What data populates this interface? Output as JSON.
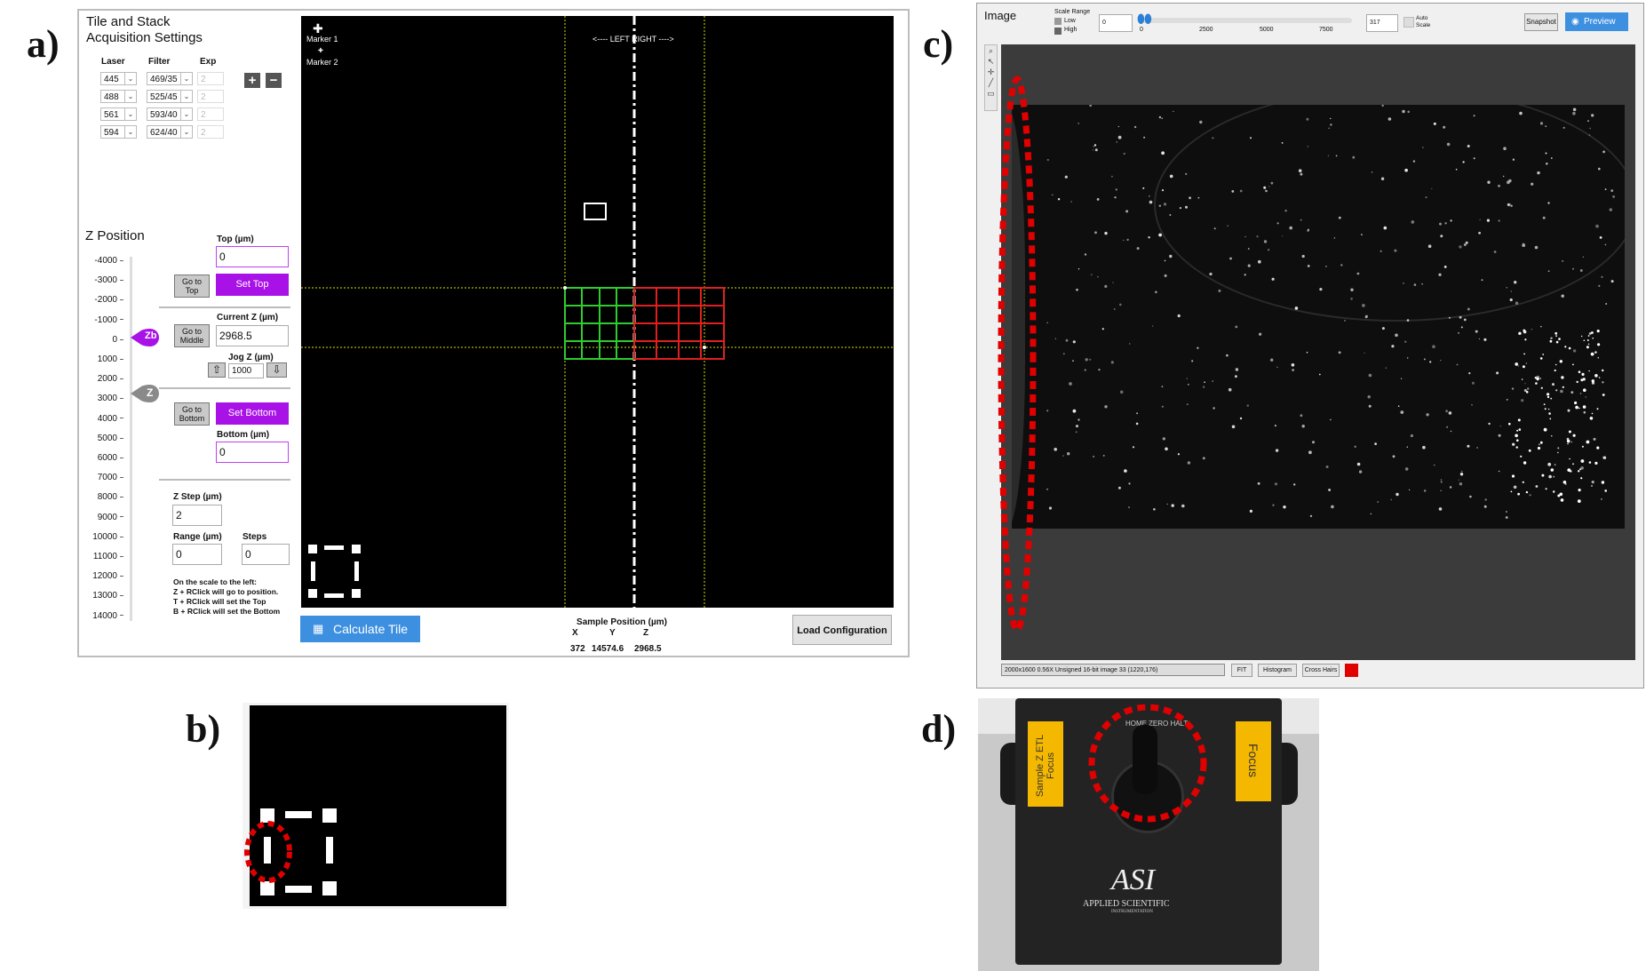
{
  "panel_labels": {
    "a": "a)",
    "b": "b)",
    "c": "c)",
    "d": "d)"
  },
  "tile": {
    "title_line1": "Tile and Stack",
    "title_line2": "Acquisition Settings",
    "col_laser": "Laser",
    "col_filter": "Filter",
    "col_exp": "Exp",
    "rows": [
      {
        "laser": "445",
        "filter": "469/35",
        "exp": "2"
      },
      {
        "laser": "488",
        "filter": "525/45",
        "exp": "2"
      },
      {
        "laser": "561",
        "filter": "593/40",
        "exp": "2"
      },
      {
        "laser": "594",
        "filter": "624/40",
        "exp": "2"
      }
    ],
    "plus": "+",
    "minus": "−",
    "z_position": "Z Position",
    "ticks": [
      "-4000",
      "-3000",
      "-2000",
      "-1000",
      "0",
      "1000",
      "2000",
      "3000",
      "4000",
      "5000",
      "6000",
      "7000",
      "8000",
      "9000",
      "10000",
      "11000",
      "12000",
      "13000",
      "14000"
    ],
    "zb_marker": "Zb",
    "z_marker": "Z",
    "top_label": "Top (µm)",
    "top_value": "0",
    "go_to_top": "Go to Top",
    "set_top": "Set Top",
    "current_z_label": "Current Z (µm)",
    "current_z_value": "2968.5",
    "go_to_middle": "Go to Middle",
    "jog_label": "Jog Z (µm)",
    "jog_value": "1000",
    "jog_up": "⇧",
    "jog_down": "⇩",
    "go_to_bottom": "Go to Bottom",
    "set_bottom": "Set Bottom",
    "bottom_label": "Bottom (µm)",
    "bottom_value": "0",
    "zstep_label": "Z Step (µm)",
    "zstep_value": "2",
    "range_label": "Range (µm)",
    "range_value": "0",
    "steps_label": "Steps",
    "steps_value": "0",
    "help_lines": [
      "On the scale to the left:",
      "Z + RClick will go to position.",
      "T + RClick will set the Top",
      "B + RClick will set the Bottom"
    ],
    "marker1": "Marker 1",
    "marker2": "Marker 2",
    "left_right": "<---- LEFT   RIGHT ---->",
    "calculate_tile": "Calculate Tile",
    "sample_pos_label": "Sample Position (µm)",
    "axes": [
      "X",
      "Y",
      "Z"
    ],
    "pos_values": [
      "372",
      "14574.6",
      "2968.5"
    ],
    "load_configuration": "Load Configuration",
    "colors": {
      "accent": "#a812e6",
      "button_blue": "#3d8fe0",
      "grid_green": "#2ecc2e",
      "grid_red": "#e02020"
    }
  },
  "image": {
    "title": "Image",
    "scale_range": "Scale Range",
    "low": "Low",
    "high": "High",
    "min_value": "0",
    "slider_ticks": [
      "0",
      "2500",
      "5000",
      "7500"
    ],
    "max_value": "317",
    "auto_scale": "Auto Scale",
    "snapshot": "Snapshot",
    "preview": "Preview",
    "status": "2000x1600 0.56X Unsigned 16-bit image 33    (1220,176)",
    "fit": "FIT",
    "histogram": "Histogram",
    "cross_hairs": "Cross Hairs"
  },
  "device": {
    "label_left": "Sample Z ETL Focus",
    "label_right": "Focus",
    "home": "HOME",
    "zero_halt": "ZERO HALT",
    "brand": "ASI",
    "company": "APPLIED SCIENTIFIC",
    "company_sub": "INSTRUMENTATION"
  }
}
